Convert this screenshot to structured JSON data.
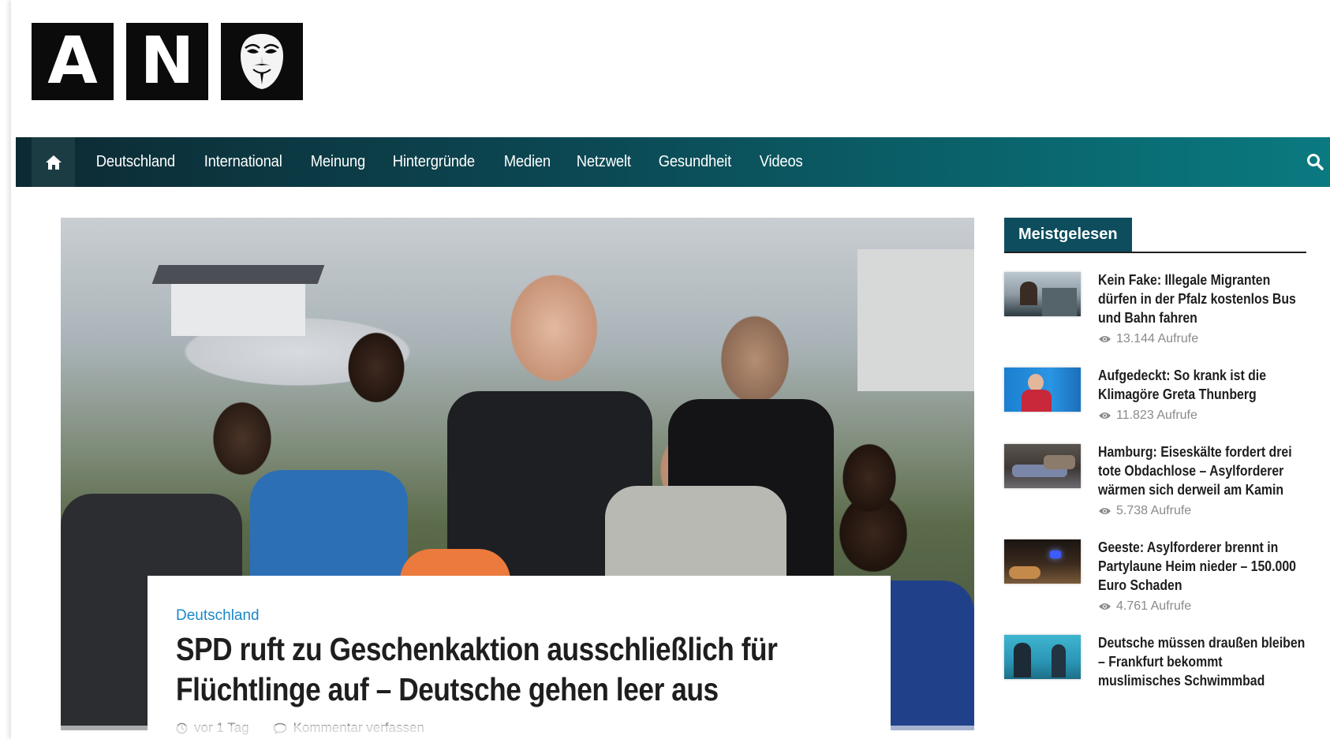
{
  "logo": {
    "letters": [
      "A",
      "N"
    ],
    "mask_icon": "guy-fawkes-mask-icon"
  },
  "nav": {
    "home_icon": "home-icon",
    "items": [
      "Deutschland",
      "International",
      "Meinung",
      "Hintergründe",
      "Medien",
      "Netzwelt",
      "Gesundheit",
      "Videos"
    ],
    "search_icon": "search-icon"
  },
  "hero": {
    "category": "Deutschland",
    "title": "SPD ruft zu Geschenkaktion ausschließlich für Flüchtlinge auf – Deutsche gehen leer aus",
    "time": "vor 1 Tag",
    "comment": "Kommentar verfassen"
  },
  "sidebar": {
    "heading": "Meistgelesen",
    "items": [
      {
        "title": "Kein Fake: Illegale Migranten dürfen in der Pfalz kostenlos Bus und Bahn fahren",
        "views": "13.144 Aufrufe"
      },
      {
        "title": "Aufgedeckt: So krank ist die Klimagöre Greta Thunberg",
        "views": "11.823 Aufrufe"
      },
      {
        "title": "Hamburg: Eiseskälte fordert drei tote Obdachlose – Asylforderer wärmen sich derweil am Kamin",
        "views": "5.738 Aufrufe"
      },
      {
        "title": "Geeste: Asylforderer brennt in Partylaune Heim nieder – 150.000 Euro Schaden",
        "views": "4.761 Aufrufe"
      },
      {
        "title": "Deutsche müssen draußen bleiben – Frankfurt bekommt muslimisches Schwimmbad",
        "views": ""
      }
    ]
  },
  "colors": {
    "nav_start": "#0d2a33",
    "nav_end": "#0a7a80",
    "category": "#1b88c8",
    "sidebar_tab": "#0d4d5d"
  }
}
